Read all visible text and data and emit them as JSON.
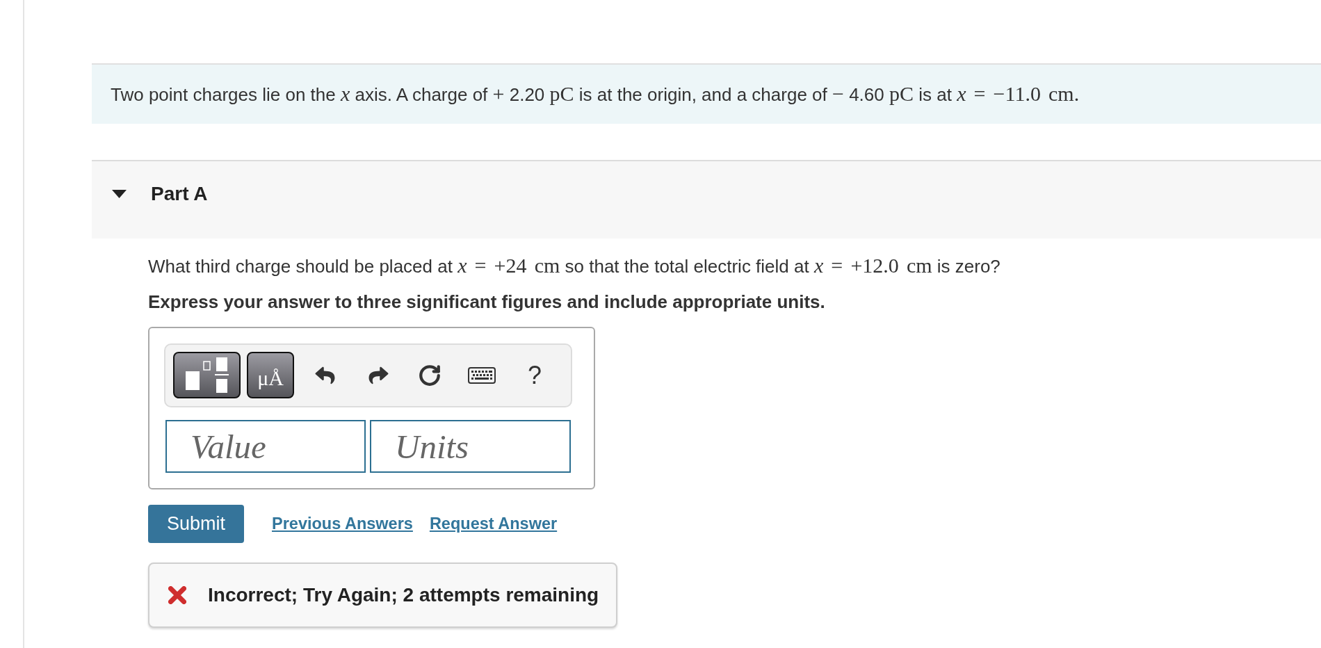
{
  "intro": {
    "parts": [
      {
        "text": "Two point charges lie on the ",
        "math": false
      },
      {
        "text": "*x*",
        "math": true
      },
      {
        "text": " axis. A charge of ",
        "math": false
      },
      {
        "text": "+",
        "math": true
      },
      {
        "text": " 2.20 ",
        "math": false
      },
      {
        "text": "pC",
        "math": true
      },
      {
        "text": " is at the origin, and a charge of ",
        "math": false
      },
      {
        "text": "−",
        "math": true
      },
      {
        "text": " 4.60 ",
        "math": false
      },
      {
        "text": "pC",
        "math": true
      },
      {
        "text": " is at ",
        "math": false
      },
      {
        "text": "*x* = −11.0 cm.",
        "math": true
      }
    ]
  },
  "part": {
    "title": "Part A",
    "expanded": true
  },
  "question": {
    "parts": [
      {
        "text": "What third charge should be placed at ",
        "math": false
      },
      {
        "text": "*x* = +24 cm",
        "math": true
      },
      {
        "text": " so that the total electric field at ",
        "math": false
      },
      {
        "text": "*x* = +12.0 cm",
        "math": true
      },
      {
        "text": " is zero?",
        "math": false
      }
    ],
    "instruction": "Express your answer to three significant figures and include appropriate units."
  },
  "answer": {
    "toolbar": {
      "units_button": "μÅ",
      "help": "?"
    },
    "value_field": {
      "placeholder": "Value"
    },
    "units_field": {
      "placeholder": "Units"
    }
  },
  "actions": {
    "submit": "Submit",
    "links": [
      "Previous Answers",
      "Request Answer"
    ]
  },
  "feedback": {
    "correct": false,
    "text": "Incorrect; Try Again; 2 attempts remaining"
  }
}
